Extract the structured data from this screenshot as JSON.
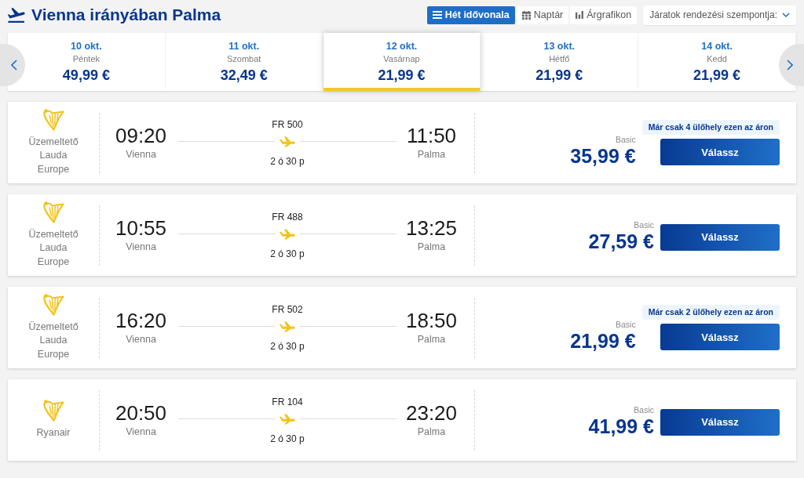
{
  "header": {
    "title": "Vienna irányában Palma"
  },
  "view_modes": [
    {
      "kind": "timeline",
      "label": "Hét idővonala",
      "selected": true
    },
    {
      "kind": "calendar",
      "label": "Naptár",
      "selected": false
    },
    {
      "kind": "chart",
      "label": "Árgrafikon",
      "selected": false
    }
  ],
  "sort_dropdown": {
    "label": "Járatok rendezési szempontja:"
  },
  "dates": [
    {
      "date": "10 okt.",
      "weekday": "Péntek",
      "price": "49,99 €",
      "selected": false
    },
    {
      "date": "11 okt.",
      "weekday": "Szombat",
      "price": "32,49 €",
      "selected": false
    },
    {
      "date": "12 okt.",
      "weekday": "Vasárnap",
      "price": "21,99 €",
      "selected": true
    },
    {
      "date": "13 okt.",
      "weekday": "Hétfő",
      "price": "21,99 €",
      "selected": false
    },
    {
      "date": "14 okt.",
      "weekday": "Kedd",
      "price": "21,99 €",
      "selected": false
    }
  ],
  "flights": [
    {
      "operator": "Üzemeltető Lauda Europe",
      "departure_time": "09:20",
      "departure_city": "Vienna",
      "flight_number": "FR 500",
      "duration": "2 ó 30 p",
      "arrival_time": "11:50",
      "arrival_city": "Palma",
      "fare": "Basic",
      "price": "35,99 €",
      "seats_notice": "Már csak 4 ülőhely ezen az áron",
      "button": "Válassz"
    },
    {
      "operator": "Üzemeltető Lauda Europe",
      "departure_time": "10:55",
      "departure_city": "Vienna",
      "flight_number": "FR 488",
      "duration": "2 ó 30 p",
      "arrival_time": "13:25",
      "arrival_city": "Palma",
      "fare": "Basic",
      "price": "27,59 €",
      "button": "Válassz"
    },
    {
      "operator": "Üzemeltető Lauda Europe",
      "departure_time": "16:20",
      "departure_city": "Vienna",
      "flight_number": "FR 502",
      "duration": "2 ó 30 p",
      "arrival_time": "18:50",
      "arrival_city": "Palma",
      "fare": "Basic",
      "price": "21,99 €",
      "seats_notice": "Már csak 2 ülőhely ezen az áron",
      "button": "Válassz"
    },
    {
      "operator": "Ryanair",
      "departure_time": "20:50",
      "departure_city": "Vienna",
      "flight_number": "FR 104",
      "duration": "2 ó 30 p",
      "arrival_time": "23:20",
      "arrival_city": "Palma",
      "fare": "Basic",
      "price": "41,99 €",
      "button": "Válassz"
    }
  ]
}
